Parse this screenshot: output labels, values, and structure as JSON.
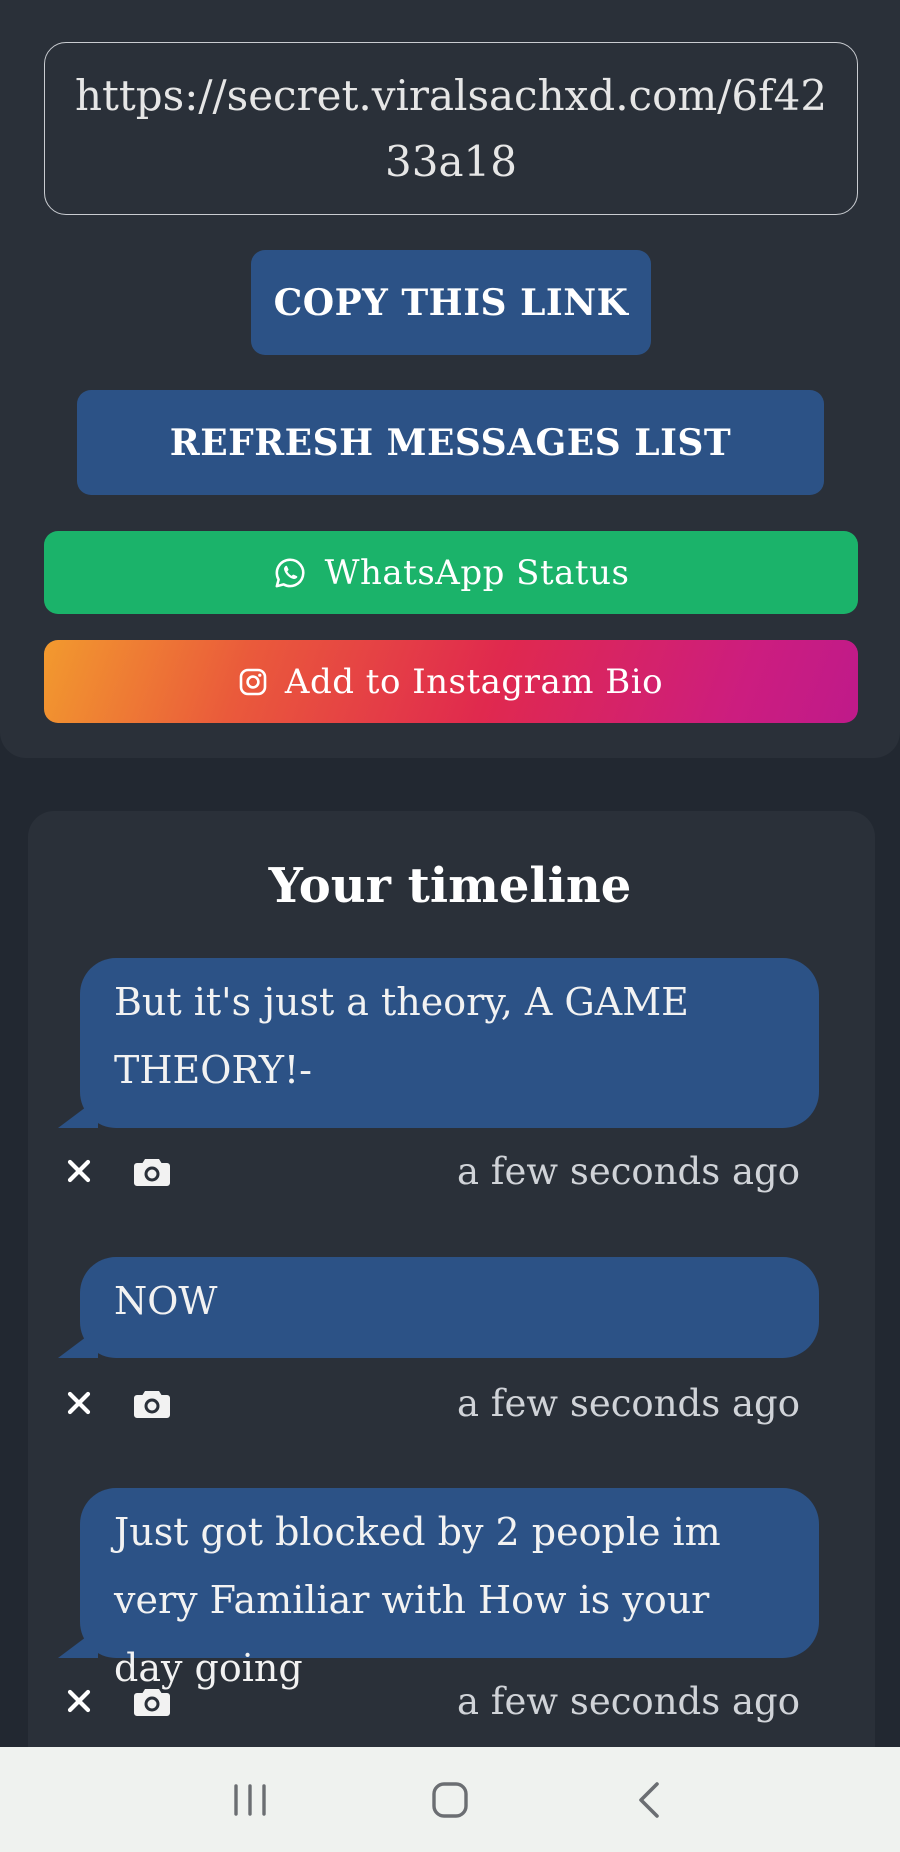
{
  "share": {
    "link": "https://secret.viralsachxd.com/6f4233a18",
    "copy_label": "COPY THIS LINK",
    "refresh_label": "REFRESH MESSAGES LIST",
    "whatsapp_label": "WhatsApp Status",
    "instagram_label": "Add to Instagram Bio"
  },
  "timeline": {
    "title": "Your timeline",
    "messages": [
      {
        "text": "But it's just a theory, A GAME THEORY!-",
        "time": "a few seconds ago"
      },
      {
        "text": "NOW",
        "time": "a few seconds ago"
      },
      {
        "text": "Just got blocked by 2 people im very Familiar with How is your day going",
        "time": "a few seconds ago"
      }
    ]
  },
  "colors": {
    "background": "#222831",
    "card": "#2a3039",
    "primary_button": "#2c5286",
    "whatsapp": "#1bb36a",
    "instagram_gradient": [
      "#f29a2e",
      "#e0294e",
      "#bf1a8a"
    ],
    "navbar": "#eff2ef"
  },
  "icons": {
    "whatsapp": "whatsapp-icon",
    "instagram": "instagram-icon",
    "delete": "close-icon",
    "screenshot": "camera-icon",
    "nav_recents": "recents-icon",
    "nav_home": "home-icon",
    "nav_back": "back-icon"
  }
}
